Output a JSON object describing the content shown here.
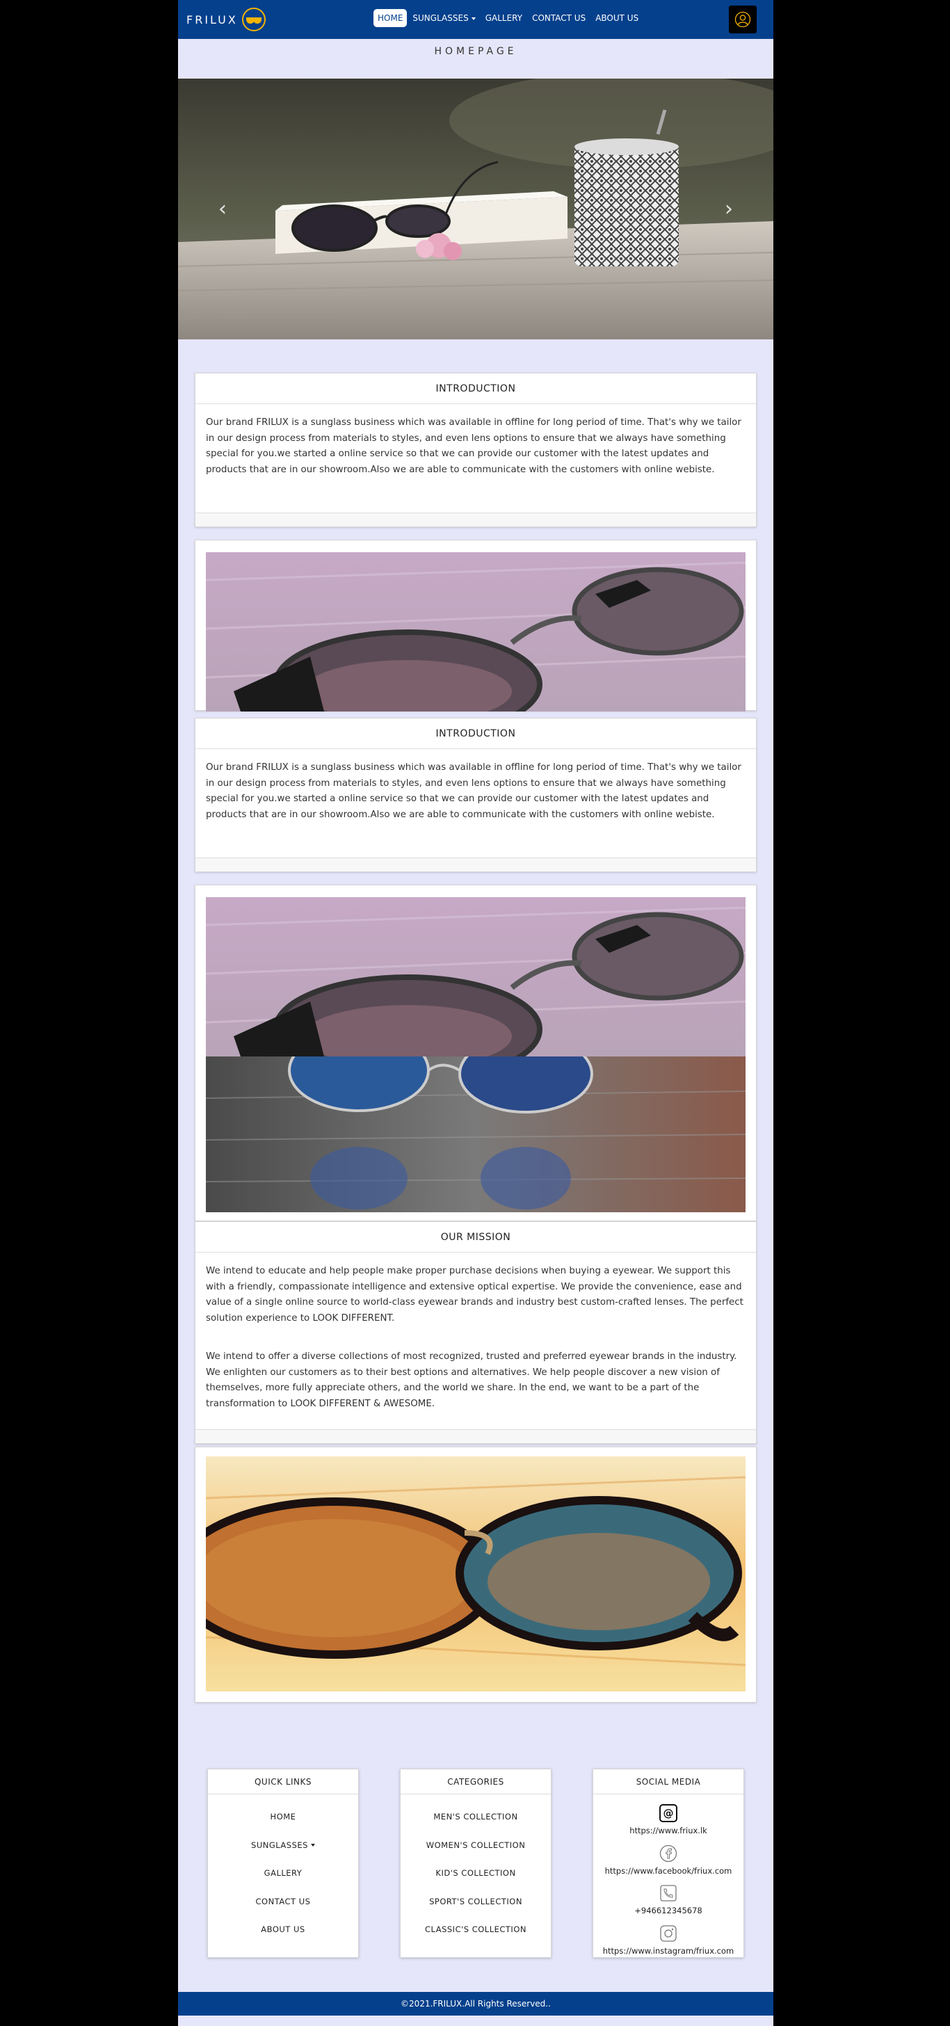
{
  "nav": {
    "brand": "FRILUX",
    "items": [
      {
        "label": "HOME",
        "active": true
      },
      {
        "label": "SUNGLASSES",
        "dropdown": true
      },
      {
        "label": "GALLERY"
      },
      {
        "label": "CONTACT US"
      },
      {
        "label": "ABOUT US"
      }
    ],
    "brand_color": "#05408c",
    "logo_color": "#f5b400"
  },
  "page_title": "HOMEPAGE",
  "carousel": {
    "prev_icon": "chevron-left-icon",
    "next_icon": "chevron-right-icon",
    "prev_glyph": "‹",
    "next_glyph": "›"
  },
  "sections": [
    {
      "header": "INTRODUCTION",
      "paragraphs": [
        "Our brand FRILUX is a sunglass business which was available in offline for long period of time. That's why we tailor in our design process from materials to styles, and even lens options to ensure that we always have something special for you.we started a online service so that we can provide our customer with the latest updates and products that are in our showroom.Also we are able to communicate with the customers with online webiste."
      ]
    },
    {
      "header": "INTRODUCTION",
      "paragraphs": [
        "Our brand FRILUX is a sunglass business which was available in offline for long period of time. That's why we tailor in our design process from materials to styles, and even lens options to ensure that we always have something special for you.we started a online service so that we can provide our customer with the latest updates and products that are in our showroom.Also we are able to communicate with the customers with online webiste."
      ]
    },
    {
      "header": "OUR MISSION",
      "paragraphs": [
        "We intend to educate and help people make proper purchase decisions when buying a eyewear. We support this with a friendly, compassionate intelligence and extensive optical expertise. We provide the convenience, ease and value of a single online source to world-class eyewear brands and industry best custom-crafted lenses. The perfect solution experience to LOOK DIFFERENT.",
        "We intend to offer a diverse collections of most recognized, trusted and preferred eyewear brands in the industry. We enlighten our customers as to their best options and alternatives. We help people discover a new vision of themselves, more fully appreciate others, and the world we share. In the end, we want to be a part of the transformation to LOOK DIFFERENT & AWESOME."
      ]
    }
  ],
  "footer": {
    "quick_links": {
      "title": "QUICK LINKS",
      "items": [
        "HOME",
        "SUNGLASSES",
        "GALLERY",
        "CONTACT US",
        "ABOUT US"
      ]
    },
    "categories": {
      "title": "CATEGORIES",
      "items": [
        "MEN'S COLLECTION",
        "WOMEN'S COLLECTION",
        "KID'S COLLECTION",
        "SPORT'S COLLECTION",
        "CLASSIC'S COLLECTION"
      ]
    },
    "social": {
      "title": "SOCIAL MEDIA",
      "items": [
        {
          "icon": "at-sign-icon",
          "label": "https://www.friux.lk"
        },
        {
          "icon": "facebook-icon",
          "label": "https://www.facebook/friux.com"
        },
        {
          "icon": "phone-icon",
          "label": "+946612345678"
        },
        {
          "icon": "instagram-icon",
          "label": "https://www.instagram/friux.com"
        }
      ]
    },
    "copyright": "©2021.FRILUX.All Rights Reserved.."
  }
}
